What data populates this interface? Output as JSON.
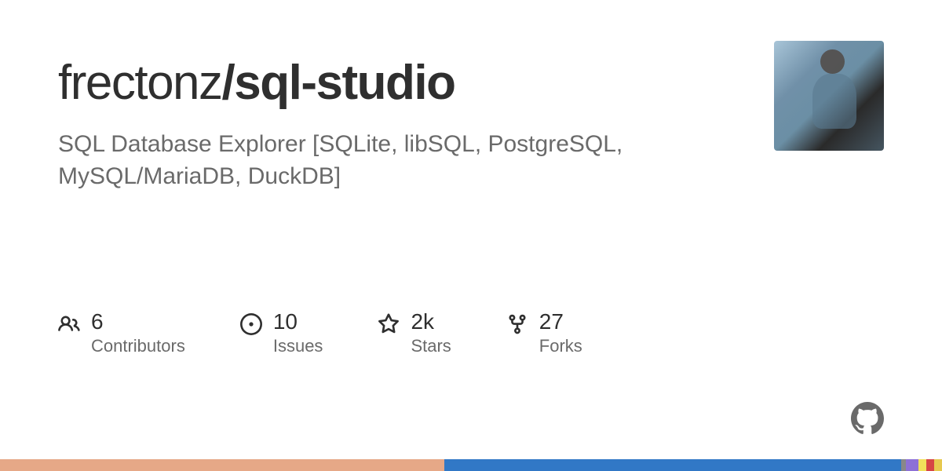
{
  "repo": {
    "owner": "frectonz",
    "separator": "/",
    "name": "sql-studio"
  },
  "description": "SQL Database Explorer [SQLite, libSQL, PostgreSQL, MySQL/MariaDB, DuckDB]",
  "stats": [
    {
      "icon": "people-icon",
      "value": "6",
      "label": "Contributors"
    },
    {
      "icon": "issue-icon",
      "value": "10",
      "label": "Issues"
    },
    {
      "icon": "star-icon",
      "value": "2k",
      "label": "Stars"
    },
    {
      "icon": "fork-icon",
      "value": "27",
      "label": "Forks"
    }
  ],
  "languages": [
    {
      "color": "#e6a887",
      "width": 47.2
    },
    {
      "color": "#3178c6",
      "width": 48.5
    },
    {
      "color": "#888888",
      "width": 0.5
    },
    {
      "color": "#8d70d6",
      "width": 1.3
    },
    {
      "color": "#f1e05a",
      "width": 0.8
    },
    {
      "color": "#d64545",
      "width": 0.9
    },
    {
      "color": "#e7c94f",
      "width": 0.8
    }
  ]
}
